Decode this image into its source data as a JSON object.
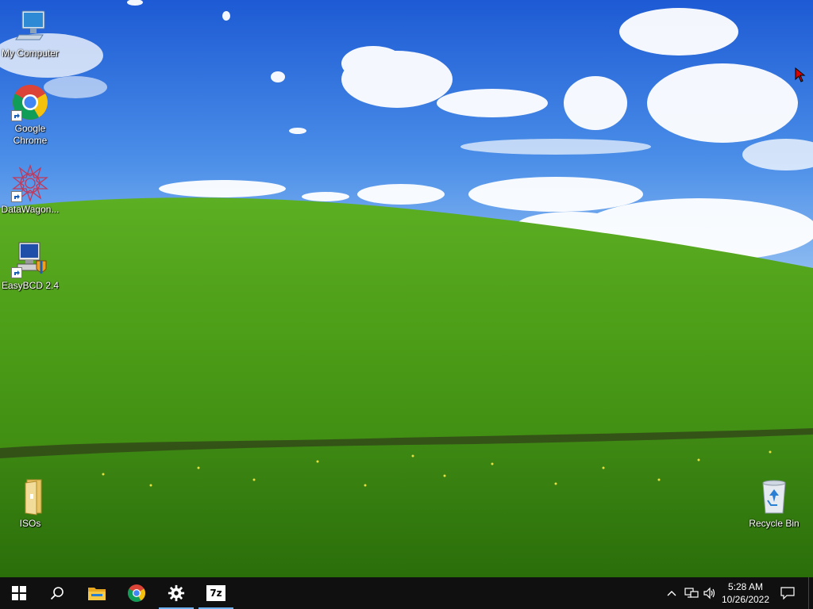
{
  "desktop": {
    "icons": [
      {
        "id": "my-computer",
        "label": "My Computer"
      },
      {
        "id": "google-chrome",
        "label": "Google Chrome"
      },
      {
        "id": "datawagon",
        "label": "DataWagon..."
      },
      {
        "id": "easybcd",
        "label": "EasyBCD 2.4"
      },
      {
        "id": "isos",
        "label": "ISOs"
      },
      {
        "id": "recycle-bin",
        "label": "Recycle Bin"
      }
    ]
  },
  "taskbar": {
    "buttons": [
      {
        "id": "start",
        "icon": "windows-logo-icon"
      },
      {
        "id": "search",
        "icon": "search-icon"
      },
      {
        "id": "file-explorer",
        "icon": "folder-icon"
      },
      {
        "id": "chrome",
        "icon": "chrome-icon"
      },
      {
        "id": "settings",
        "icon": "gear-icon",
        "active": true
      },
      {
        "id": "7zip",
        "icon": "seven-zip-icon",
        "label": "7z",
        "active": true
      }
    ],
    "tray": {
      "icons": [
        "chevron-up-icon",
        "network-icon",
        "volume-icon"
      ],
      "time": "5:28 AM",
      "date": "10/26/2022",
      "notification_icon": "action-center-icon"
    }
  },
  "colors": {
    "taskbar_bg": "#101010",
    "active_indicator": "#6fb2f0",
    "sky_top": "#1f5fd6",
    "grass": "#4a9a1c"
  }
}
